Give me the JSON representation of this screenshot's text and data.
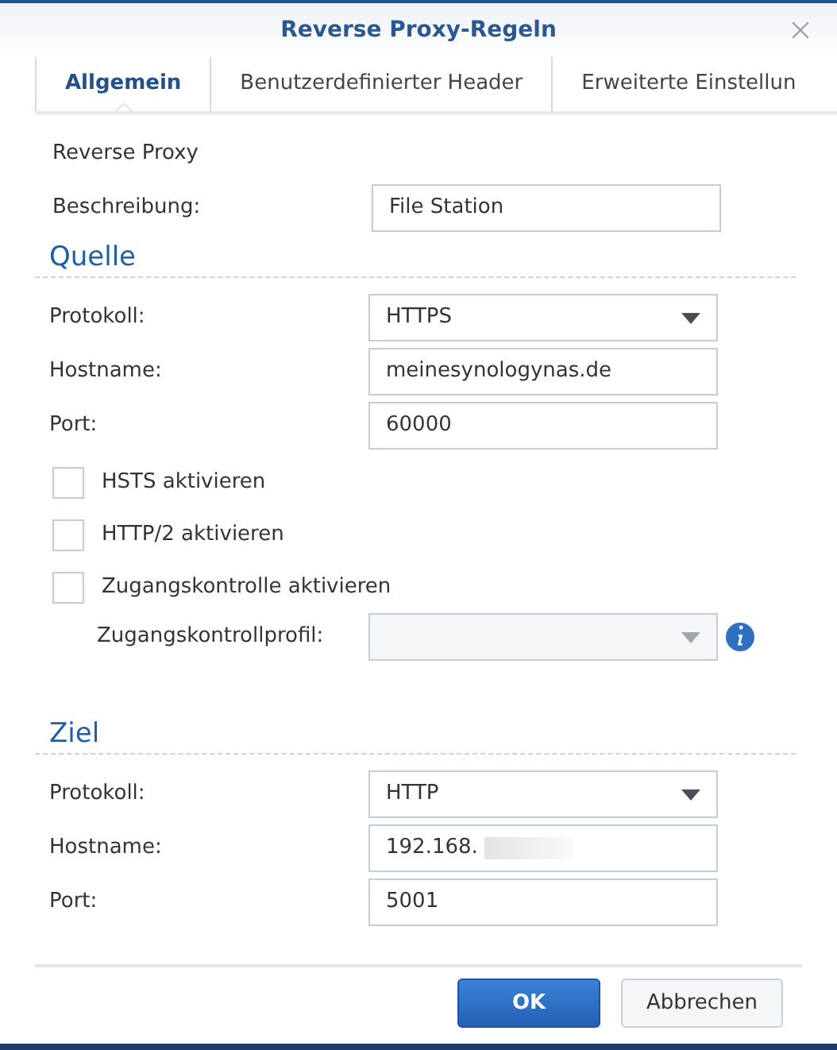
{
  "window": {
    "title": "Reverse Proxy-Regeln"
  },
  "tabs": [
    {
      "label": "Allgemein",
      "selected": true
    },
    {
      "label": "Benutzerdefinierter Header",
      "selected": false
    },
    {
      "label": "Erweiterte Einstellun",
      "selected": false
    }
  ],
  "intro": {
    "title": "Reverse Proxy",
    "fields": [
      {
        "kind": "text",
        "label": "Beschreibung:",
        "value": "File Station",
        "redacted": false
      }
    ]
  },
  "sections": [
    {
      "title": "Quelle",
      "fields": [
        {
          "kind": "select",
          "label": "Protokoll:",
          "value": "HTTPS",
          "disabled": false,
          "info": false
        },
        {
          "kind": "text",
          "label": "Hostname:",
          "value": "meinesynologynas.de",
          "redacted": false
        },
        {
          "kind": "text",
          "label": "Port:",
          "value": "60000",
          "redacted": false
        },
        {
          "kind": "checkbox",
          "label": "HSTS aktivieren",
          "checked": false
        },
        {
          "kind": "checkbox",
          "label": "HTTP/2 aktivieren",
          "checked": false
        },
        {
          "kind": "checkbox",
          "label": "Zugangskontrolle aktivieren",
          "checked": false,
          "children": [
            {
              "kind": "select",
              "label": "Zugangskontrollprofil:",
              "disabled": true,
              "info": true
            }
          ]
        }
      ]
    },
    {
      "title": "Ziel",
      "fields": [
        {
          "kind": "select",
          "label": "Protokoll:",
          "value": "HTTP",
          "disabled": false,
          "info": false
        },
        {
          "kind": "text",
          "label": "Hostname:",
          "value": "192.168.",
          "redacted": true
        },
        {
          "kind": "text",
          "label": "Port:",
          "value": "5001",
          "redacted": false
        }
      ]
    }
  ],
  "buttons": [
    {
      "label": "OK",
      "kind": "primary"
    },
    {
      "label": "Abbrechen",
      "kind": "secondary"
    }
  ]
}
